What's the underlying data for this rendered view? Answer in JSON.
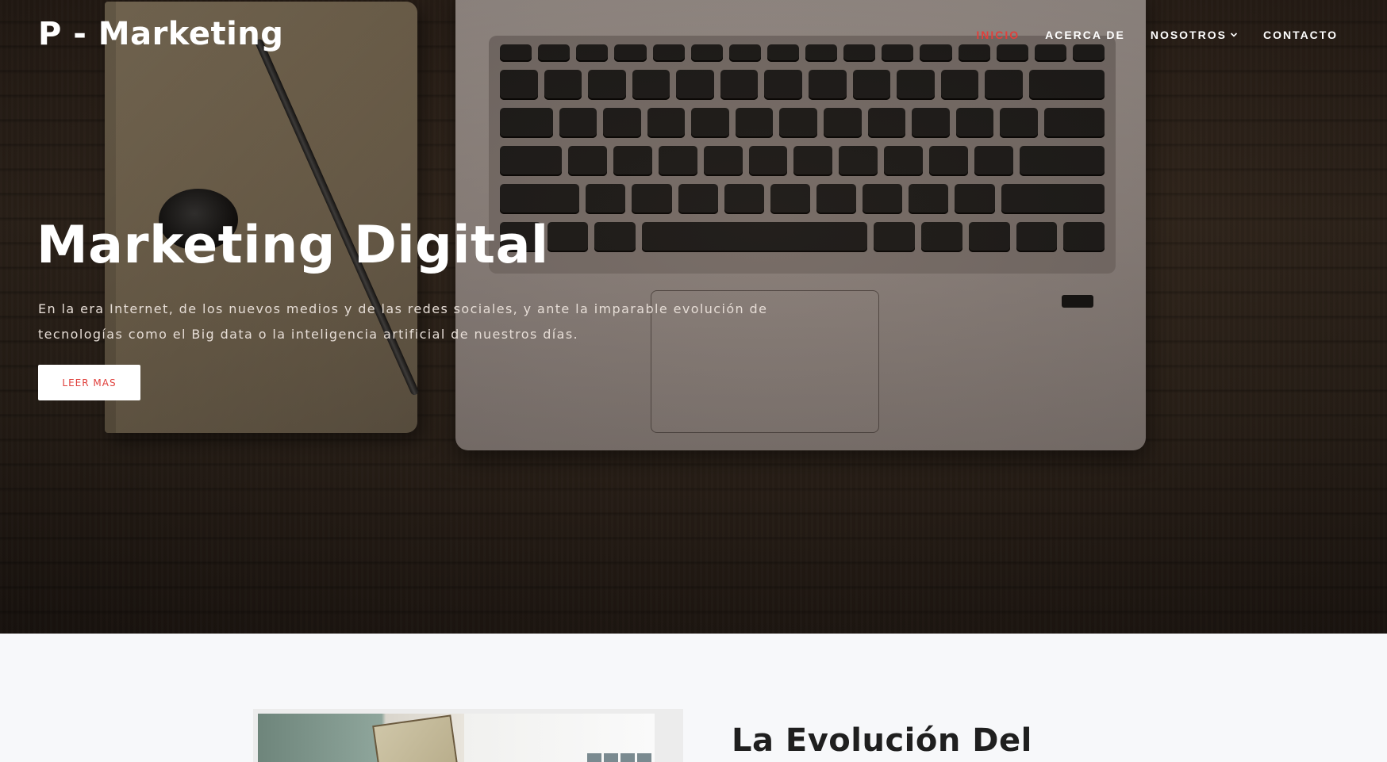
{
  "brand": {
    "name": "P - Marketing"
  },
  "nav": {
    "items": [
      {
        "label": "INICIO",
        "active": true
      },
      {
        "label": "ACERCA DE",
        "active": false
      },
      {
        "label": "NOSOTROS",
        "active": false,
        "has_dropdown": true
      },
      {
        "label": "CONTACTO",
        "active": false
      }
    ],
    "dropdown_icon": "chevron-down-icon"
  },
  "hero": {
    "title": "Marketing Digital",
    "text": "En la era Internet, de los nuevos medios y de las redes sociales, y ante la imparable evolución de tecnologías como el Big data o la inteligencia artificial de nuestros días.",
    "cta_label": "LEER MAS"
  },
  "section": {
    "title": "La Evolución Del"
  },
  "colors": {
    "accent": "#e0403c",
    "white": "#ffffff",
    "section_bg": "#f7f8fa",
    "heading_dark": "#1f1f1f"
  }
}
